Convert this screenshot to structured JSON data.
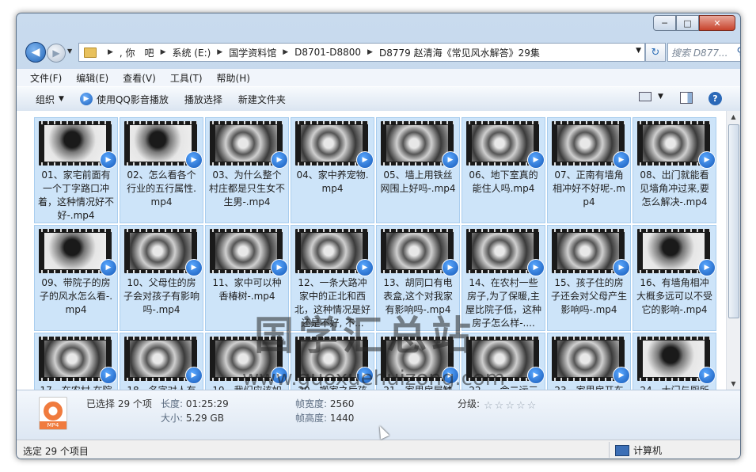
{
  "window": {
    "caption_buttons": {
      "minimize": "─",
      "maximize": "□",
      "close": "✕"
    }
  },
  "nav": {
    "back_glyph": "◀",
    "forward_glyph": "▶",
    "breadcrumbs": [
      ", 你　吧",
      "系统 (E:)",
      "国学资料馆",
      "D8701-D8800",
      "D8779 赵清海《常见风水解答》29集"
    ],
    "search_placeholder": "搜索 D877...",
    "refresh_glyph": "↻"
  },
  "menu": [
    "文件(F)",
    "编辑(E)",
    "查看(V)",
    "工具(T)",
    "帮助(H)"
  ],
  "toolbar": {
    "organize": "组织",
    "play_qq": "使用QQ影音播放",
    "play_selection": "播放选择",
    "new_folder": "新建文件夹"
  },
  "files": [
    {
      "name": "01、家宅前面有一个丁字路口冲着，这种情况好不好-.mp4",
      "thumb": "a"
    },
    {
      "name": "02、怎么看各个行业的五行属性.mp4",
      "thumb": "a"
    },
    {
      "name": "03、为什么整个村庄都是只生女不生男-.mp4",
      "thumb": "b"
    },
    {
      "name": "04、家中养宠物.mp4",
      "thumb": "b"
    },
    {
      "name": "05、墙上用铁丝网围上好吗-.mp4",
      "thumb": "b"
    },
    {
      "name": "06、地下室真的能住人吗.mp4",
      "thumb": "b"
    },
    {
      "name": "07、正南有墙角相冲好不好呢-.mp4",
      "thumb": "b"
    },
    {
      "name": "08、出门就能看见墙角冲过来,要怎么解决-.mp4",
      "thumb": "b"
    },
    {
      "name": "09、带院子的房子的风水怎么看-.mp4",
      "thumb": "a"
    },
    {
      "name": "10、父母住的房子会对孩子有影响吗-.mp4",
      "thumb": "b"
    },
    {
      "name": "11、家中可以种香椿树-.mp4",
      "thumb": "b"
    },
    {
      "name": "12、一条大路冲家中的正北和西北，这种情况是好还是不好, 不...",
      "thumb": "b"
    },
    {
      "name": "13、胡同口有电表盒,这个对我家有影响吗-.mp4",
      "thumb": "b"
    },
    {
      "name": "14、在农村一些房子,为了保暖,主屋比院子低，这种房子怎么样-....",
      "thumb": "b"
    },
    {
      "name": "15、孩子住的房子还会对父母产生影响吗-.mp4",
      "thumb": "b"
    },
    {
      "name": "16、有墙角相冲大概多远可以不受它的影响-.mp4",
      "thumb": "a"
    },
    {
      "name": "17、在农村,在院",
      "thumb": "b"
    },
    {
      "name": "18、名字对人有",
      "thumb": "b"
    },
    {
      "name": "19、我们应该如",
      "thumb": "b"
    },
    {
      "name": "20、搬家之后孩",
      "thumb": "b"
    },
    {
      "name": "21、家里房屋缺",
      "thumb": "b"
    },
    {
      "name": "22、一命二运三",
      "thumb": "b"
    },
    {
      "name": "23、家里房开东",
      "thumb": "b"
    },
    {
      "name": "24、大门与厕所",
      "thumb": "a"
    }
  ],
  "watermark": {
    "title": "国学汇总站",
    "url": "www.guoxuehuizong.com"
  },
  "details": {
    "selected": "已选择 29 个项",
    "length_label": "长度:",
    "length_value": "01:25:29",
    "size_label": "大小:",
    "size_value": "5.29 GB",
    "fw_label": "帧宽度:",
    "fw_value": "2560",
    "fh_label": "帧高度:",
    "fh_value": "1440",
    "rating_label": "分级:",
    "icon_ext": "MP4"
  },
  "status": {
    "left": "选定 29 个项目",
    "right": "计算机"
  },
  "colors": {
    "selection": "#cde4f9",
    "frame": "#b8cde5"
  }
}
